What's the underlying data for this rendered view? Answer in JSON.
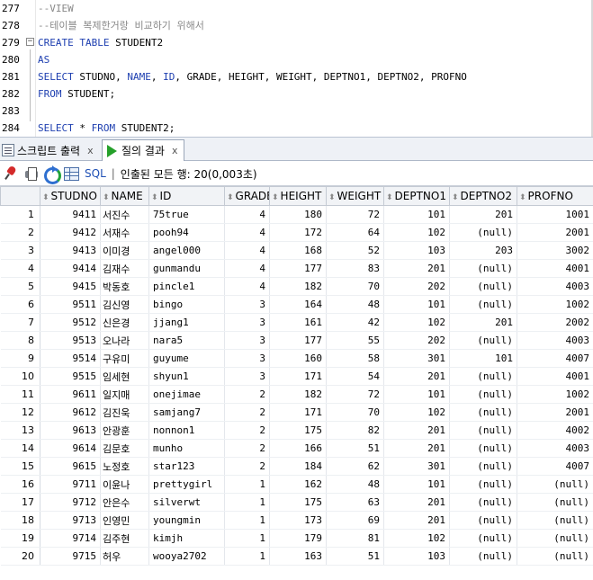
{
  "editor": {
    "lines": [
      {
        "num": "277",
        "parts": [
          {
            "t": "--VIEW",
            "c": "cmt"
          }
        ]
      },
      {
        "num": "278",
        "parts": [
          {
            "t": "--테이블 복제한거랑 비교하기 위해서",
            "c": "cmt"
          }
        ]
      },
      {
        "num": "279",
        "fold": "−",
        "parts": [
          {
            "t": "CREATE TABLE",
            "c": "kw"
          },
          {
            "t": " STUDENT2",
            "c": "plain"
          }
        ]
      },
      {
        "num": "280",
        "parts": [
          {
            "t": "AS",
            "c": "kw"
          }
        ]
      },
      {
        "num": "281",
        "parts": [
          {
            "t": "SELECT",
            "c": "kw"
          },
          {
            "t": " STUDNO, ",
            "c": "plain"
          },
          {
            "t": "NAME",
            "c": "kw"
          },
          {
            "t": ", ",
            "c": "plain"
          },
          {
            "t": "ID",
            "c": "kw"
          },
          {
            "t": ", GRADE, HEIGHT, WEIGHT, DEPTNO1, DEPTNO2, PROFNO",
            "c": "plain"
          }
        ]
      },
      {
        "num": "282",
        "parts": [
          {
            "t": "FROM",
            "c": "kw"
          },
          {
            "t": " STUDENT;",
            "c": "plain"
          }
        ]
      },
      {
        "num": "283",
        "parts": []
      },
      {
        "num": "284",
        "parts": [
          {
            "t": "SELECT",
            "c": "kw"
          },
          {
            "t": " * ",
            "c": "plain"
          },
          {
            "t": "FROM",
            "c": "kw"
          },
          {
            "t": " STUDENT2;",
            "c": "plain"
          }
        ]
      }
    ]
  },
  "tabs": [
    {
      "label": "스크립트 출력",
      "close": "x",
      "icon": "script-output-icon"
    },
    {
      "label": "질의 결과",
      "close": "x",
      "icon": "run-query-icon"
    }
  ],
  "toolbar": {
    "sql_label": "SQL",
    "separator": "|",
    "status": "인출된 모든 행: 20(0,003초)"
  },
  "grid": {
    "columns": [
      "STUDNO",
      "NAME",
      "ID",
      "GRADE",
      "HEIGHT",
      "WEIGHT",
      "DEPTNO1",
      "DEPTNO2",
      "PROFNO"
    ],
    "rows": [
      [
        "1",
        "9411",
        "서진수",
        "75true",
        "4",
        "180",
        "72",
        "101",
        "201",
        "1001"
      ],
      [
        "2",
        "9412",
        "서재수",
        "pooh94",
        "4",
        "172",
        "64",
        "102",
        "(null)",
        "2001"
      ],
      [
        "3",
        "9413",
        "이미경",
        "angel000",
        "4",
        "168",
        "52",
        "103",
        "203",
        "3002"
      ],
      [
        "4",
        "9414",
        "김재수",
        "gunmandu",
        "4",
        "177",
        "83",
        "201",
        "(null)",
        "4001"
      ],
      [
        "5",
        "9415",
        "박동호",
        "pincle1",
        "4",
        "182",
        "70",
        "202",
        "(null)",
        "4003"
      ],
      [
        "6",
        "9511",
        "김신영",
        "bingo",
        "3",
        "164",
        "48",
        "101",
        "(null)",
        "1002"
      ],
      [
        "7",
        "9512",
        "신은경",
        "jjang1",
        "3",
        "161",
        "42",
        "102",
        "201",
        "2002"
      ],
      [
        "8",
        "9513",
        "오나라",
        "nara5",
        "3",
        "177",
        "55",
        "202",
        "(null)",
        "4003"
      ],
      [
        "9",
        "9514",
        "구유미",
        "guyume",
        "3",
        "160",
        "58",
        "301",
        "101",
        "4007"
      ],
      [
        "10",
        "9515",
        "임세현",
        "shyun1",
        "3",
        "171",
        "54",
        "201",
        "(null)",
        "4001"
      ],
      [
        "11",
        "9611",
        "일지매",
        "onejimae",
        "2",
        "182",
        "72",
        "101",
        "(null)",
        "1002"
      ],
      [
        "12",
        "9612",
        "김진욱",
        "samjang7",
        "2",
        "171",
        "70",
        "102",
        "(null)",
        "2001"
      ],
      [
        "13",
        "9613",
        "안광훈",
        "nonnon1",
        "2",
        "175",
        "82",
        "201",
        "(null)",
        "4002"
      ],
      [
        "14",
        "9614",
        "김문호",
        "munho",
        "2",
        "166",
        "51",
        "201",
        "(null)",
        "4003"
      ],
      [
        "15",
        "9615",
        "노정호",
        "star123",
        "2",
        "184",
        "62",
        "301",
        "(null)",
        "4007"
      ],
      [
        "16",
        "9711",
        "이윤나",
        "prettygirl",
        "1",
        "162",
        "48",
        "101",
        "(null)",
        "(null)"
      ],
      [
        "17",
        "9712",
        "안은수",
        "silverwt",
        "1",
        "175",
        "63",
        "201",
        "(null)",
        "(null)"
      ],
      [
        "18",
        "9713",
        "인영민",
        "youngmin",
        "1",
        "173",
        "69",
        "201",
        "(null)",
        "(null)"
      ],
      [
        "19",
        "9714",
        "김주현",
        "kimjh",
        "1",
        "179",
        "81",
        "102",
        "(null)",
        "(null)"
      ],
      [
        "20",
        "9715",
        "허우",
        "wooya2702",
        "1",
        "163",
        "51",
        "103",
        "(null)",
        "(null)"
      ]
    ]
  }
}
